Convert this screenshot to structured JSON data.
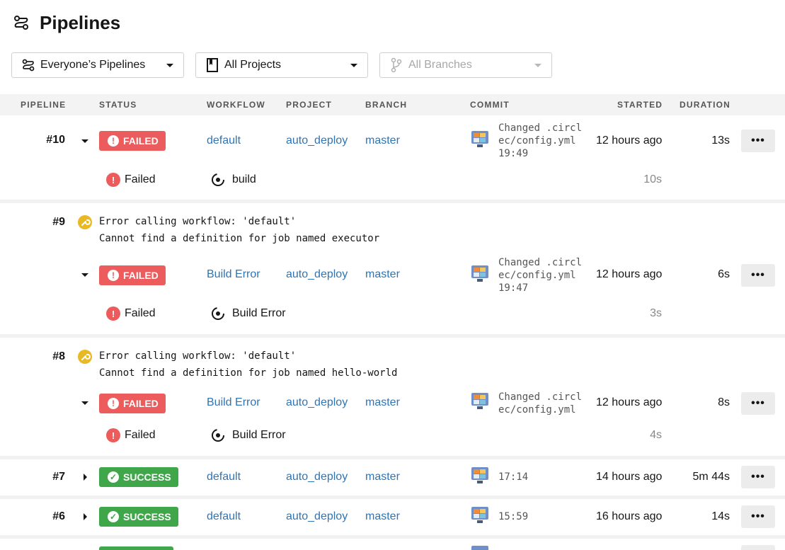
{
  "page": {
    "title": "Pipelines"
  },
  "filters": {
    "pipelines": "Everyone’s Pipelines",
    "projects": "All Projects",
    "branches": "All Branches"
  },
  "columns": {
    "pipeline": "PIPELINE",
    "status": "STATUS",
    "workflow": "WORKFLOW",
    "project": "PROJECT",
    "branch": "BRANCH",
    "commit": "COMMIT",
    "started": "STARTED",
    "duration": "DURATION"
  },
  "colors": {
    "failed": "#ed5c5c",
    "success": "#3fa64a",
    "link": "#2f74b5",
    "warning": "#e8b923"
  },
  "pipelines": [
    {
      "number": "#10",
      "status": "FAILED",
      "workflow": "default",
      "project": "auto_deploy",
      "branch": "master",
      "commit": [
        "Changed .circl",
        "ec/config.yml",
        "19:49"
      ],
      "started": "12 hours ago",
      "duration": "13s",
      "more": "•••",
      "job": {
        "status": "Failed",
        "name": "build",
        "duration": "10s"
      }
    },
    {
      "number": "#9",
      "error": [
        "Error calling workflow: 'default'",
        "Cannot find a definition for job named executor"
      ],
      "status": "FAILED",
      "workflow": "Build Error",
      "project": "auto_deploy",
      "branch": "master",
      "commit": [
        "Changed .circl",
        "ec/config.yml",
        "19:47"
      ],
      "started": "12 hours ago",
      "duration": "6s",
      "more": "•••",
      "job": {
        "status": "Failed",
        "name": "Build Error",
        "duration": "3s"
      }
    },
    {
      "number": "#8",
      "error": [
        "Error calling workflow: 'default'",
        "Cannot find a definition for job named hello-world"
      ],
      "status": "FAILED",
      "workflow": "Build Error",
      "project": "auto_deploy",
      "branch": "master",
      "commit": [
        "Changed .circl",
        "ec/config.yml"
      ],
      "started": "12 hours ago",
      "duration": "8s",
      "more": "•••",
      "job": {
        "status": "Failed",
        "name": "Build Error",
        "duration": "4s"
      }
    },
    {
      "number": "#7",
      "status": "SUCCESS",
      "workflow": "default",
      "project": "auto_deploy",
      "branch": "master",
      "commit": [
        "17:14"
      ],
      "started": "14 hours ago",
      "duration": "5m 44s",
      "more": "•••"
    },
    {
      "number": "#6",
      "status": "SUCCESS",
      "workflow": "default",
      "project": "auto_deploy",
      "branch": "master",
      "commit": [
        "15:59"
      ],
      "started": "16 hours ago",
      "duration": "14s",
      "more": "•••"
    }
  ],
  "icons": {
    "title": "pipelines-icon",
    "pipelines_filter": "pipelines-icon",
    "projects_filter": "bookmark-icon",
    "branches_filter": "branch-icon",
    "failed_badge": "exclamation-icon",
    "success_badge": "check-icon",
    "job": "workflow-job-icon",
    "error": "wrench-icon",
    "avatar": "commit-avatar"
  }
}
